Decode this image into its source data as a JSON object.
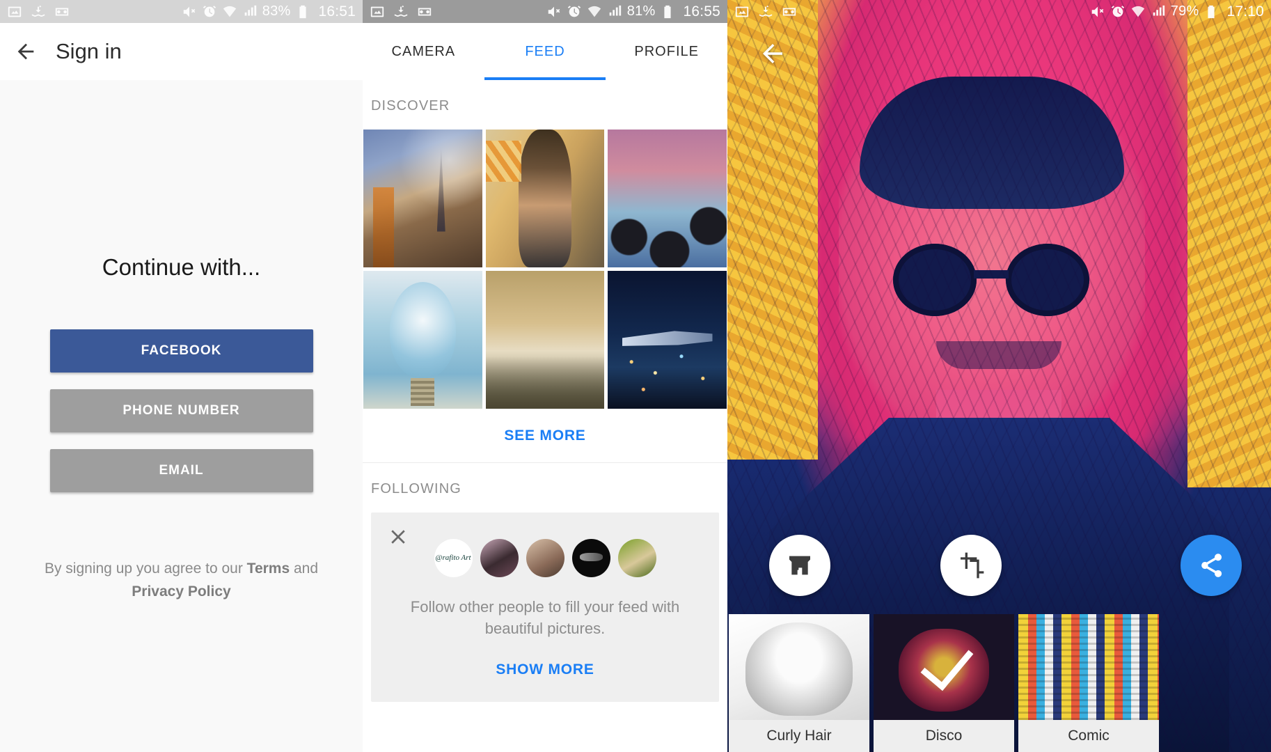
{
  "screens": [
    {
      "id": "signin",
      "statusbar": {
        "left_icons": [
          "image-icon",
          "download-hand-icon",
          "voicemail-icon"
        ],
        "right_icons": [
          "mute-vibrate-icon",
          "alarm-icon",
          "wifi-icon",
          "signal-icon"
        ],
        "battery": "83%",
        "time": "16:51"
      },
      "appbar": {
        "back_icon": "back-arrow-icon",
        "title": "Sign in"
      },
      "heading": "Continue with...",
      "buttons": [
        {
          "label": "FACEBOOK",
          "color": "#3b5998"
        },
        {
          "label": "PHONE NUMBER",
          "color": "#9e9e9e"
        },
        {
          "label": "EMAIL",
          "color": "#9e9e9e"
        }
      ],
      "terms": {
        "prefix": "By signing up you agree to our ",
        "terms_link": "Terms",
        "middle": " and",
        "privacy_link": "Privacy Policy"
      }
    },
    {
      "id": "feed",
      "statusbar": {
        "left_icons": [
          "image-icon",
          "download-hand-icon",
          "voicemail-icon"
        ],
        "right_icons": [
          "mute-vibrate-icon",
          "alarm-icon",
          "wifi-icon",
          "signal-icon"
        ],
        "battery": "81%",
        "time": "16:55"
      },
      "tabs": [
        {
          "label": "CAMERA",
          "active": false
        },
        {
          "label": "FEED",
          "active": true
        },
        {
          "label": "PROFILE",
          "active": false
        }
      ],
      "discover": {
        "label": "DISCOVER",
        "tiles": [
          {
            "name": "paris-street-photo",
            "style": "ph-paris"
          },
          {
            "name": "woman-poster-photo",
            "style": "ph-woman"
          },
          {
            "name": "palm-trees-sky-photo",
            "style": "ph-palms"
          },
          {
            "name": "ship-in-bulb-photo",
            "style": "ph-bulb"
          },
          {
            "name": "dunes-sunset-photo",
            "style": "ph-dunes"
          },
          {
            "name": "airplane-night-photo",
            "style": "ph-plane"
          }
        ],
        "see_more": "SEE MORE"
      },
      "following": {
        "label": "FOLLOWING",
        "close_icon": "close-icon",
        "avatars": [
          {
            "name": "avatar-rafito-art",
            "caption": "@rafito Art",
            "style": "av1"
          },
          {
            "name": "avatar-user-2",
            "caption": "",
            "style": "av2"
          },
          {
            "name": "avatar-user-3",
            "caption": "",
            "style": "av3"
          },
          {
            "name": "avatar-user-4",
            "caption": "",
            "style": "av4"
          },
          {
            "name": "avatar-user-5",
            "caption": "",
            "style": "av5"
          }
        ],
        "message": "Follow other people to fill your feed with beautiful pictures.",
        "show_more": "SHOW MORE"
      }
    },
    {
      "id": "filter-preview",
      "statusbar": {
        "right_icons": [
          "mute-vibrate-icon",
          "alarm-icon",
          "wifi-icon",
          "signal-icon"
        ],
        "battery": "79%",
        "time": "17:10"
      },
      "back_icon": "back-arrow-icon",
      "artwork_name": "stylized-portrait-artwork",
      "actions": [
        {
          "name": "store-button",
          "icon": "store-icon",
          "variant": "white"
        },
        {
          "name": "crop-button",
          "icon": "crop-icon",
          "variant": "white"
        },
        {
          "name": "share-button",
          "icon": "share-icon",
          "variant": "blue"
        }
      ],
      "filters": [
        {
          "label": "Curly Hair",
          "selected": false,
          "style": "fil-anime"
        },
        {
          "label": "Disco",
          "selected": true,
          "style": "fil-disco"
        },
        {
          "label": "Comic",
          "selected": false,
          "style": "fil-comic"
        }
      ]
    }
  ],
  "colors": {
    "accent_blue": "#1a7ef5",
    "facebook_blue": "#3b5998",
    "grey_button": "#9e9e9e",
    "share_blue": "#2b8cf0"
  }
}
